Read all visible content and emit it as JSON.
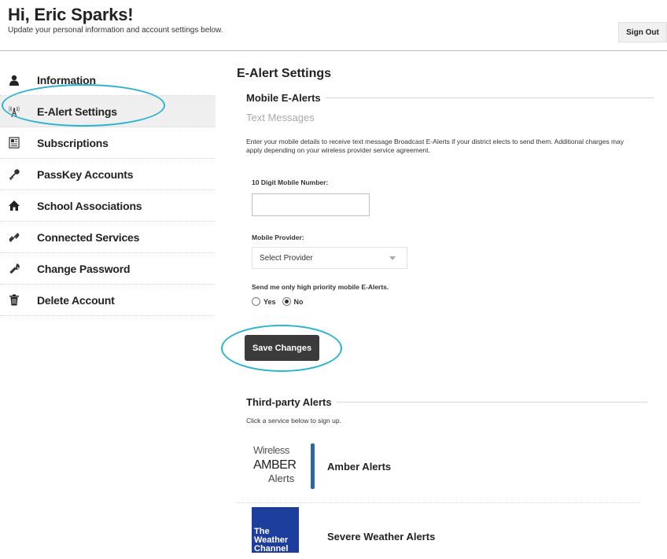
{
  "header": {
    "greeting": "Hi, Eric Sparks!",
    "subtitle": "Update your personal information and account settings below.",
    "signout_label": "Sign Out"
  },
  "sidebar": {
    "items": [
      {
        "label": "Information",
        "icon": "user-icon"
      },
      {
        "label": "E-Alert Settings",
        "icon": "antenna-icon",
        "active": true
      },
      {
        "label": "Subscriptions",
        "icon": "newspaper-icon"
      },
      {
        "label": "PassKey Accounts",
        "icon": "key-icon"
      },
      {
        "label": "School Associations",
        "icon": "house-icon"
      },
      {
        "label": "Connected Services",
        "icon": "link-icon"
      },
      {
        "label": "Change Password",
        "icon": "wrench-icon"
      },
      {
        "label": "Delete Account",
        "icon": "trash-icon"
      }
    ]
  },
  "main": {
    "title": "E-Alert Settings",
    "mobile_section": "Mobile E-Alerts",
    "text_messages": "Text Messages",
    "description": "Enter your mobile details to receive text message Broadcast E-Alerts if your district elects to send them. Additional charges may apply depending on your wireless provider service agreement.",
    "mobile_number_label": "10 Digit Mobile Number:",
    "mobile_number_value": "",
    "provider_label": "Mobile Provider:",
    "provider_selected": "Select Provider",
    "priority_label": "Send me only high priority mobile E-Alerts.",
    "priority_yes": "Yes",
    "priority_no": "No",
    "priority_selected": "No",
    "save_label": "Save Changes",
    "third_party_section": "Third-party Alerts",
    "third_party_desc": "Click a service below to sign up.",
    "services": [
      {
        "label": "Amber Alerts",
        "logo": {
          "line1": "Wireless",
          "line2": "AMBER",
          "line3": "Alerts"
        }
      },
      {
        "label": "Severe Weather Alerts",
        "logo": {
          "line1": "The",
          "line2": "Weather",
          "line3": "Channel"
        }
      }
    ]
  },
  "colors": {
    "highlight_ring": "#2bb3d1",
    "save_button": "#3b3b3b",
    "active_nav_bg": "#efefef",
    "twc_blue": "#1d3e9c",
    "amber_blue": "#2a67a8"
  }
}
